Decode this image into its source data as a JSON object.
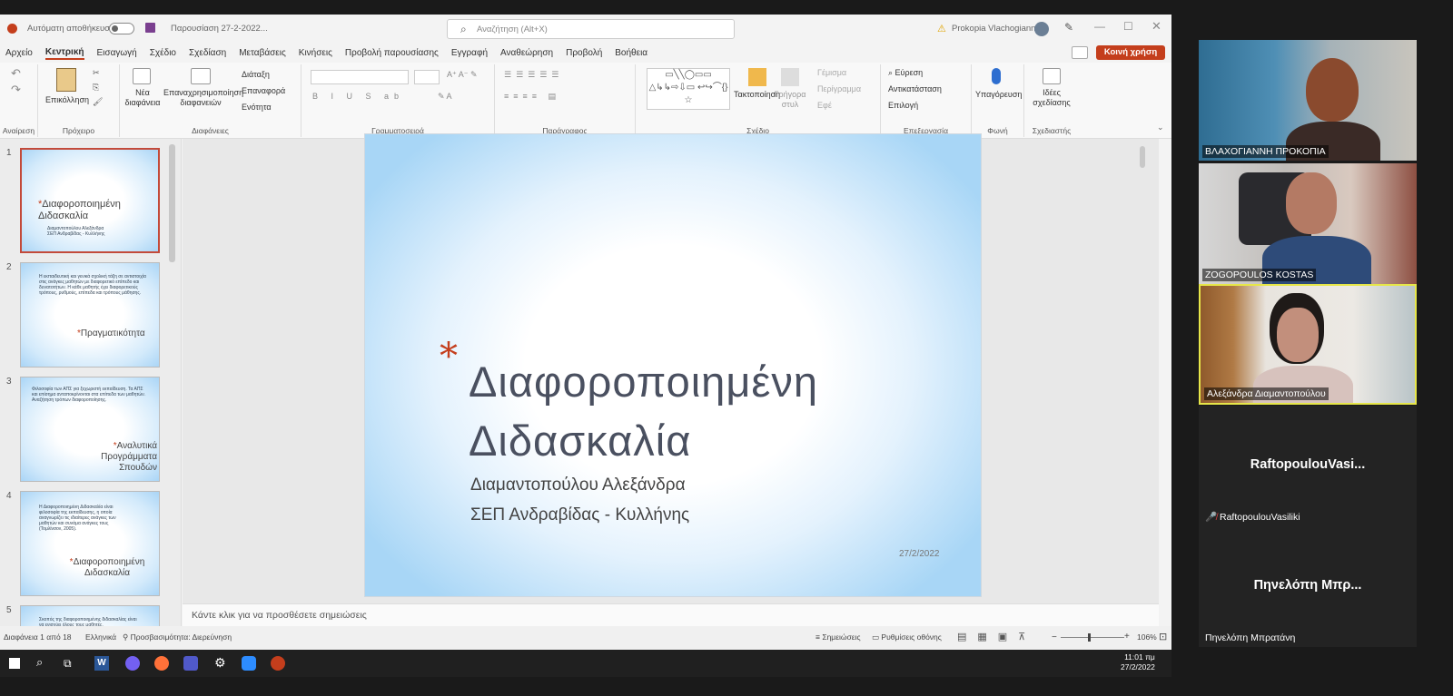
{
  "window": {
    "autosave": "Αυτόματη αποθήκευση",
    "doc_title": "Παρουσίαση 27-2-2022...",
    "search_placeholder": "Αναζήτηση (Alt+X)",
    "user": "Prokopia Vlachogianni",
    "share": "Κοινή χρήση"
  },
  "menu": [
    "Αρχείο",
    "Κεντρική",
    "Εισαγωγή",
    "Σχέδιο",
    "Σχεδίαση",
    "Μεταβάσεις",
    "Κινήσεις",
    "Προβολή παρουσίασης",
    "Εγγραφή",
    "Αναθεώρηση",
    "Προβολή",
    "Βοήθεια"
  ],
  "ribbon": {
    "undo_label": "Αναίρεση",
    "paste": "Επικόλληση",
    "clipboard": "Πρόχειρο",
    "new_slide": "Νέα διαφάνεια",
    "reuse": "Επαναχρησιμοποίηση διαφανειών",
    "layout": "Διάταξη",
    "reset": "Επαναφορά",
    "section": "Ενότητα",
    "slides": "Διαφάνειες",
    "font": "Γραμματοσειρά",
    "paragraph": "Παράγραφος",
    "arrange": "Τακτοποίηση",
    "quick_styles": "Γρήγορα στυλ",
    "fill": "Γέμισμα",
    "outline": "Περίγραμμα",
    "effects": "Εφέ",
    "drawing": "Σχέδιο",
    "find": "Εύρεση",
    "replace": "Αντικατάσταση",
    "select": "Επιλογή",
    "editing": "Επεξεργασία",
    "dictate": "Υπαγόρευση",
    "voice": "Φωνή",
    "ideas": "Ιδέες σχεδίασης",
    "designer": "Σχεδιαστής"
  },
  "thumbnails": [
    {
      "num": "1",
      "title": "Διαφοροποιημένη Διδασκαλία",
      "body": "Διαμαντοπούλου Αλεξάνδρα ΣΕΠ Ανδραβίδας - Κυλλήνης"
    },
    {
      "num": "2",
      "title": "Πραγματικότητα",
      "body": "Η εκπαιδευτική και γενικά σχολική τάξη σε αντιστοιχία στις ανάγκες μαθητών με διαφορετικό επίπεδο και δυνατοτήτων. Η κάθε μαθητής έχει διαφορετικούς τρόπους, ρυθμούς, επίπεδα και τρόπους μάθησης."
    },
    {
      "num": "3",
      "title": "Αναλυτικά Προγράμματα Σπουδών",
      "body": "Φιλοσοφία των ΑΠΣ για ξεχωριστή εκπαίδευση. Τα ΑΠΣ και επίσημα ανταποκρίνονται στα επίπεδα των μαθητών. Αναζήτηση τρόπων διαφοροποίησης."
    },
    {
      "num": "4",
      "title": "Διαφοροποιημένη Διδασκαλία",
      "body": "Η Διαφοροποιημένη Διδασκαλία είναι φιλοσοφία της εκπαίδευσης, η οποία αναγνωρίζει τις ιδιαίτερες ανάγκες των μαθητών και συνάμα ανάγκες τους (Τομλίνσον, 2005)."
    },
    {
      "num": "5",
      "title": "",
      "body": "Σκοπός της διαφοροποιημένης διδασκαλίας είναι να ενισχύει όλους τους μαθητές."
    }
  ],
  "slide": {
    "title_line1": "Διαφοροποιημένη",
    "title_line2": "Διδασκαλία",
    "subtitle_line1": "Διαμαντοπούλου Αλεξάνδρα",
    "subtitle_line2": "ΣΕΠ Ανδραβίδας - Κυλλήνης",
    "date": "27/2/2022",
    "bullet": "*"
  },
  "notes_placeholder": "Κάντε κλικ για να προσθέσετε σημειώσεις",
  "status": {
    "slide": "Διαφάνεια 1 από 18",
    "lang": "Ελληνικά",
    "access": "Προσβασιμότητα: Διερεύνηση",
    "notes": "Σημειώσεις",
    "display": "Ρυθμίσεις οθόνης",
    "zoom": "106%"
  },
  "taskbar": {
    "time": "11:01 πμ",
    "date": "27/2/2022"
  },
  "participants": [
    {
      "name": "ΒΛΑΧΟΓΙΑΝΝΗ ΠΡΟΚΟΠΙΑ"
    },
    {
      "name": "ZOGOPOULOS KOSTAS"
    },
    {
      "name": "Αλεξάνδρα Διαμαντοπούλου"
    },
    {
      "name": "RaftopoulouVasiliki",
      "display": "RaftopoulouVasi..."
    },
    {
      "name": "Πηνελόπη Μπρατάνη",
      "display": "Πηνελόπη Μπρ..."
    }
  ]
}
